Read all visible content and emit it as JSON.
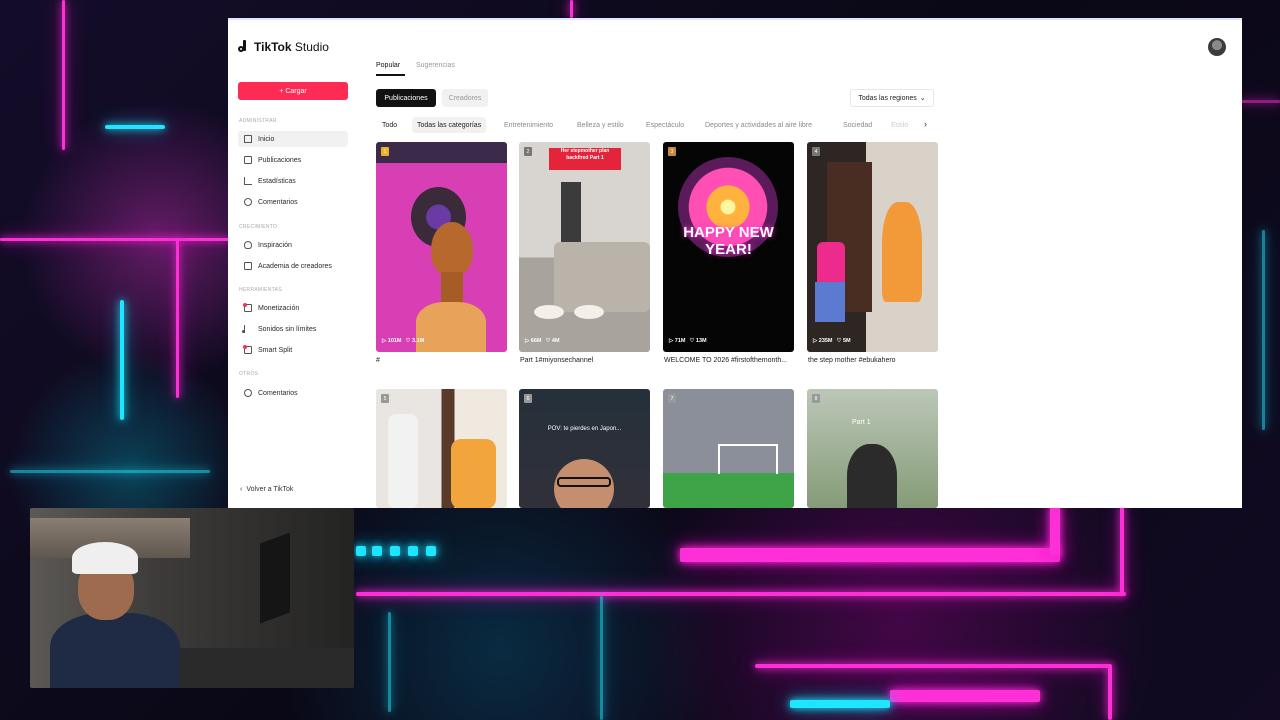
{
  "app": {
    "brand": "TikTok",
    "product": "Studio"
  },
  "sidebar": {
    "upload_label": "+ Cargar",
    "sections": {
      "admin": "ADMINISTRAR",
      "growth": "CRECIMIENTO",
      "tools": "HERRAMIENTAS",
      "others": "OTROS"
    },
    "items": [
      {
        "label": "Inicio",
        "icon": "home-icon"
      },
      {
        "label": "Publicaciones",
        "icon": "posts-icon"
      },
      {
        "label": "Estadísticas",
        "icon": "analytics-icon"
      },
      {
        "label": "Comentarios",
        "icon": "comments-icon"
      },
      {
        "label": "Inspiración",
        "icon": "bulb-icon"
      },
      {
        "label": "Academia de creadores",
        "icon": "academy-icon"
      },
      {
        "label": "Monetización",
        "icon": "monetization-icon"
      },
      {
        "label": "Sonidos sin límites",
        "icon": "music-note-icon"
      },
      {
        "label": "Smart Split",
        "icon": "split-icon"
      },
      {
        "label": "Comentarios",
        "icon": "feedback-icon"
      }
    ],
    "back_label": "Volver a TikTok"
  },
  "main": {
    "tabs": [
      "Popular",
      "Sugerencias"
    ],
    "content_types": [
      "Publicaciones",
      "Creadores"
    ],
    "region_label": "Todas las regiones",
    "categories": [
      "Todo",
      "Todas las categorías",
      "Entretenimiento",
      "Belleza y estilo",
      "Espectáculo",
      "Deportes y actividades al aire libre",
      "Sociedad",
      "Estilo"
    ],
    "videos": [
      {
        "rank": "1",
        "views": "▷ 101M",
        "likes": "♡ 3.1M",
        "caption": "#"
      },
      {
        "rank": "2",
        "views": "▷ 66M",
        "likes": "♡ 4M",
        "caption": "Part 1#miyonsechannel",
        "banner": "Her stepmother plan backfired Part 1"
      },
      {
        "rank": "3",
        "views": "▷ 71M",
        "likes": "♡ 13M",
        "caption": "WELCOME TO 2026 #firstofthemonth...",
        "overlay": "HAPPY NEW YEAR!"
      },
      {
        "rank": "4",
        "views": "▷ 235M",
        "likes": "♡ 5M",
        "caption": "the step mother #ebukahero"
      },
      {
        "rank": "5"
      },
      {
        "rank": "6",
        "overlay": "POV: te pierdes en Japon..."
      },
      {
        "rank": "7"
      },
      {
        "rank": "8",
        "overlay": "Part 1"
      }
    ]
  },
  "colors": {
    "accent": "#fe2c55",
    "neon_magenta": "#ff2fd8",
    "neon_cyan": "#1fe6ff"
  }
}
